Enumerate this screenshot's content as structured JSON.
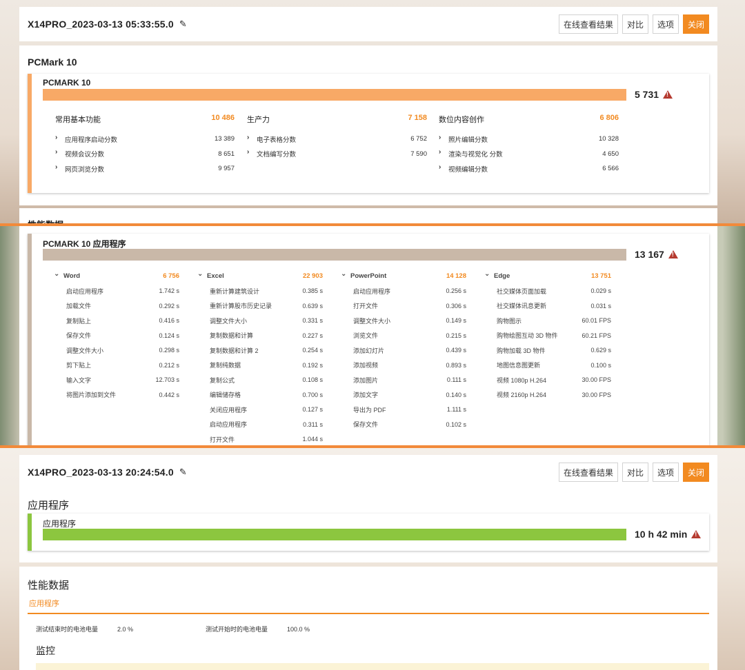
{
  "panel1": {
    "header": {
      "title": "X14PRO_2023-03-13 05:33:55.0",
      "buttons": [
        "在线查看结果",
        "对比",
        "选项",
        "关闭"
      ]
    },
    "section_title": "PCMark 10",
    "result": {
      "name": "PCMARK 10",
      "score": "5 731",
      "bar_fill": 1.0,
      "bar_color": "#f8a966"
    },
    "groups": [
      {
        "name": "常用基本功能",
        "score": "10 486",
        "items": [
          {
            "label": "应用程序启动分数",
            "value": "13 389"
          },
          {
            "label": "视频会议分数",
            "value": "8 651"
          },
          {
            "label": "网页浏览分数",
            "value": "9 957"
          }
        ]
      },
      {
        "name": "生产力",
        "score": "7 158",
        "items": [
          {
            "label": "电子表格分数",
            "value": "6 752"
          },
          {
            "label": "文档编写分数",
            "value": "7 590"
          }
        ]
      },
      {
        "name": "数位内容创作",
        "score": "6 806",
        "items": [
          {
            "label": "照片编辑分数",
            "value": "10 328"
          },
          {
            "label": "渲染与视觉化 分数",
            "value": "4 650"
          },
          {
            "label": "视频编辑分数",
            "value": "6 566"
          }
        ]
      }
    ],
    "cut_text": "性能数据"
  },
  "panel2": {
    "result": {
      "name": "PCMARK 10 应用程序",
      "score": "13 167",
      "bar_fill": 1.0,
      "bar_color": "#c9b8a8"
    },
    "apps": [
      {
        "name": "Word",
        "score": "6 756",
        "items": [
          {
            "label": "启动应用程序",
            "value": "1.742 s"
          },
          {
            "label": "加载文件",
            "value": "0.292 s"
          },
          {
            "label": "复制贴上",
            "value": "0.416 s"
          },
          {
            "label": "保存文件",
            "value": "0.124 s"
          },
          {
            "label": "调整文件大小",
            "value": "0.298 s"
          },
          {
            "label": "剪下贴上",
            "value": "0.212 s"
          },
          {
            "label": "输入文字",
            "value": "12.703 s"
          },
          {
            "label": "将图片添加到文件",
            "value": "0.442 s"
          }
        ]
      },
      {
        "name": "Excel",
        "score": "22 903",
        "items": [
          {
            "label": "重新计算建筑设计",
            "value": "0.385 s"
          },
          {
            "label": "重新计算股市历史记录",
            "value": "0.639 s"
          },
          {
            "label": "调整文件大小",
            "value": "0.331 s"
          },
          {
            "label": "复制数据和计算",
            "value": "0.227 s"
          },
          {
            "label": "复制数据和计算 2",
            "value": "0.254 s"
          },
          {
            "label": "复制纯数据",
            "value": "0.192 s"
          },
          {
            "label": "复制公式",
            "value": "0.108 s"
          },
          {
            "label": "编辑储存格",
            "value": "0.700 s"
          },
          {
            "label": "关闭应用程序",
            "value": "0.127 s"
          },
          {
            "label": "启动应用程序",
            "value": "0.311 s"
          },
          {
            "label": "打开文件",
            "value": "1.044 s"
          }
        ]
      },
      {
        "name": "PowerPoint",
        "score": "14 128",
        "items": [
          {
            "label": "启动应用程序",
            "value": "0.256 s"
          },
          {
            "label": "打开文件",
            "value": "0.306 s"
          },
          {
            "label": "调整文件大小",
            "value": "0.149 s"
          },
          {
            "label": "浏览文件",
            "value": "0.215 s"
          },
          {
            "label": "添加幻灯片",
            "value": "0.439 s"
          },
          {
            "label": "添加视频",
            "value": "0.893 s"
          },
          {
            "label": "添加图片",
            "value": "0.111 s"
          },
          {
            "label": "添加文字",
            "value": "0.140 s"
          },
          {
            "label": "导出为 PDF",
            "value": "1.111 s"
          },
          {
            "label": "保存文件",
            "value": "0.102 s"
          }
        ]
      },
      {
        "name": "Edge",
        "score": "13 751",
        "items": [
          {
            "label": "社交媒体页面加载",
            "value": "0.029 s"
          },
          {
            "label": "社交媒体讯息更新",
            "value": "0.031 s"
          },
          {
            "label": "购物图示",
            "value": "60.01 FPS"
          },
          {
            "label": "购物绘图互动 3D 物件",
            "value": "60.21 FPS"
          },
          {
            "label": "购物加载 3D 物件",
            "value": "0.629 s"
          },
          {
            "label": "地图信息图更新",
            "value": "0.100 s"
          },
          {
            "label": "视频 1080p H.264",
            "value": "30.00 FPS"
          },
          {
            "label": "视频 2160p H.264",
            "value": "30.00 FPS"
          }
        ]
      }
    ]
  },
  "panel3": {
    "header": {
      "title": "X14PRO_2023-03-13 20:24:54.0",
      "buttons": [
        "在线查看结果",
        "对比",
        "选项",
        "关闭"
      ]
    },
    "section_title": "应用程序",
    "result": {
      "name": "应用程序",
      "score": "10 h 42 min",
      "bar_fill": 1.0,
      "bar_color": "#8cc63f"
    },
    "perf": {
      "title": "性能数据",
      "tab": "应用程序",
      "kv": [
        {
          "label": "测试结束时的电池电量",
          "value": "2.0 %"
        },
        {
          "label": "测试开始时的电池电量",
          "value": "100.0 %"
        }
      ],
      "monitor": "监控"
    }
  },
  "colors": {
    "accent": "#f28a20",
    "frame": "#f28a3a",
    "warn": "#b53a2f"
  }
}
